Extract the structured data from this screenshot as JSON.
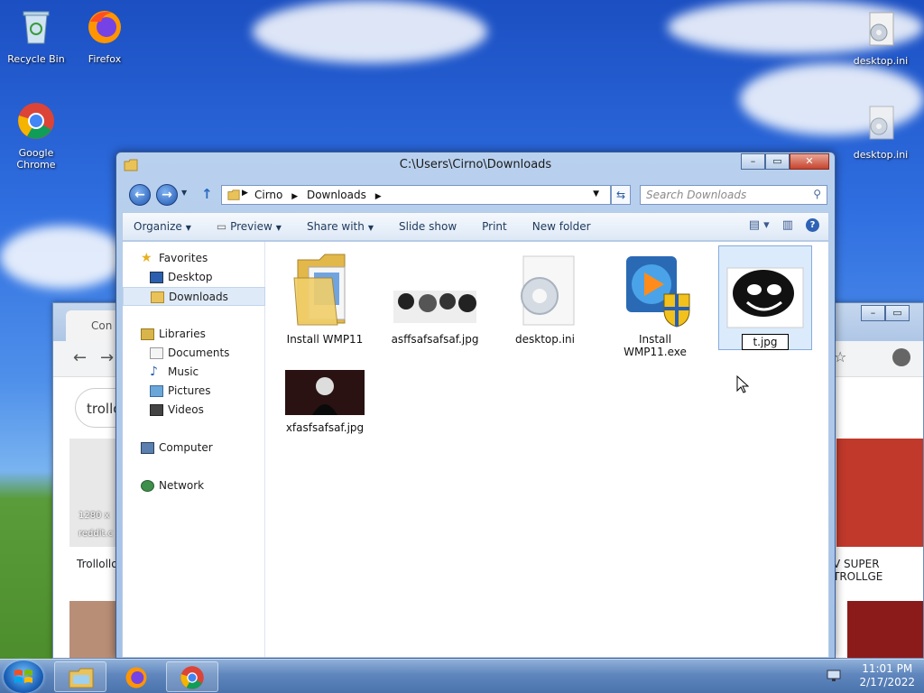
{
  "desktop": {
    "icons": [
      {
        "label": "Recycle Bin"
      },
      {
        "label": "Firefox"
      },
      {
        "label": "Google Chrome"
      },
      {
        "label": "desktop.ini"
      },
      {
        "label": "desktop.ini"
      }
    ]
  },
  "browser_bg": {
    "tab_label": "Con",
    "search_value": "trollo",
    "captions": [
      "Trollollo",
      "V SUPER TROLLGE"
    ],
    "thumb_meta": [
      "1280 x",
      "reddit.c"
    ]
  },
  "explorer": {
    "title": "C:\\Users\\Cirno\\Downloads",
    "breadcrumb": [
      "Cirno",
      "Downloads"
    ],
    "search_placeholder": "Search Downloads",
    "toolbar": {
      "organize": "Organize",
      "preview": "Preview",
      "share_with": "Share with",
      "slide_show": "Slide show",
      "print": "Print",
      "new_folder": "New folder"
    },
    "nav": {
      "favorites": "Favorites",
      "desktop": "Desktop",
      "downloads": "Downloads",
      "libraries": "Libraries",
      "documents": "Documents",
      "music": "Music",
      "pictures": "Pictures",
      "videos": "Videos",
      "computer": "Computer",
      "network": "Network"
    },
    "files": [
      {
        "name": "Install WMP11"
      },
      {
        "name": "asffsafsafsaf.jpg"
      },
      {
        "name": "desktop.ini"
      },
      {
        "name": "Install WMP11.exe"
      },
      {
        "name": "t.jpg"
      },
      {
        "name": "xfasfsafsaf.jpg"
      }
    ]
  },
  "taskbar": {
    "time": "11:01 PM",
    "date": "2/17/2022"
  }
}
